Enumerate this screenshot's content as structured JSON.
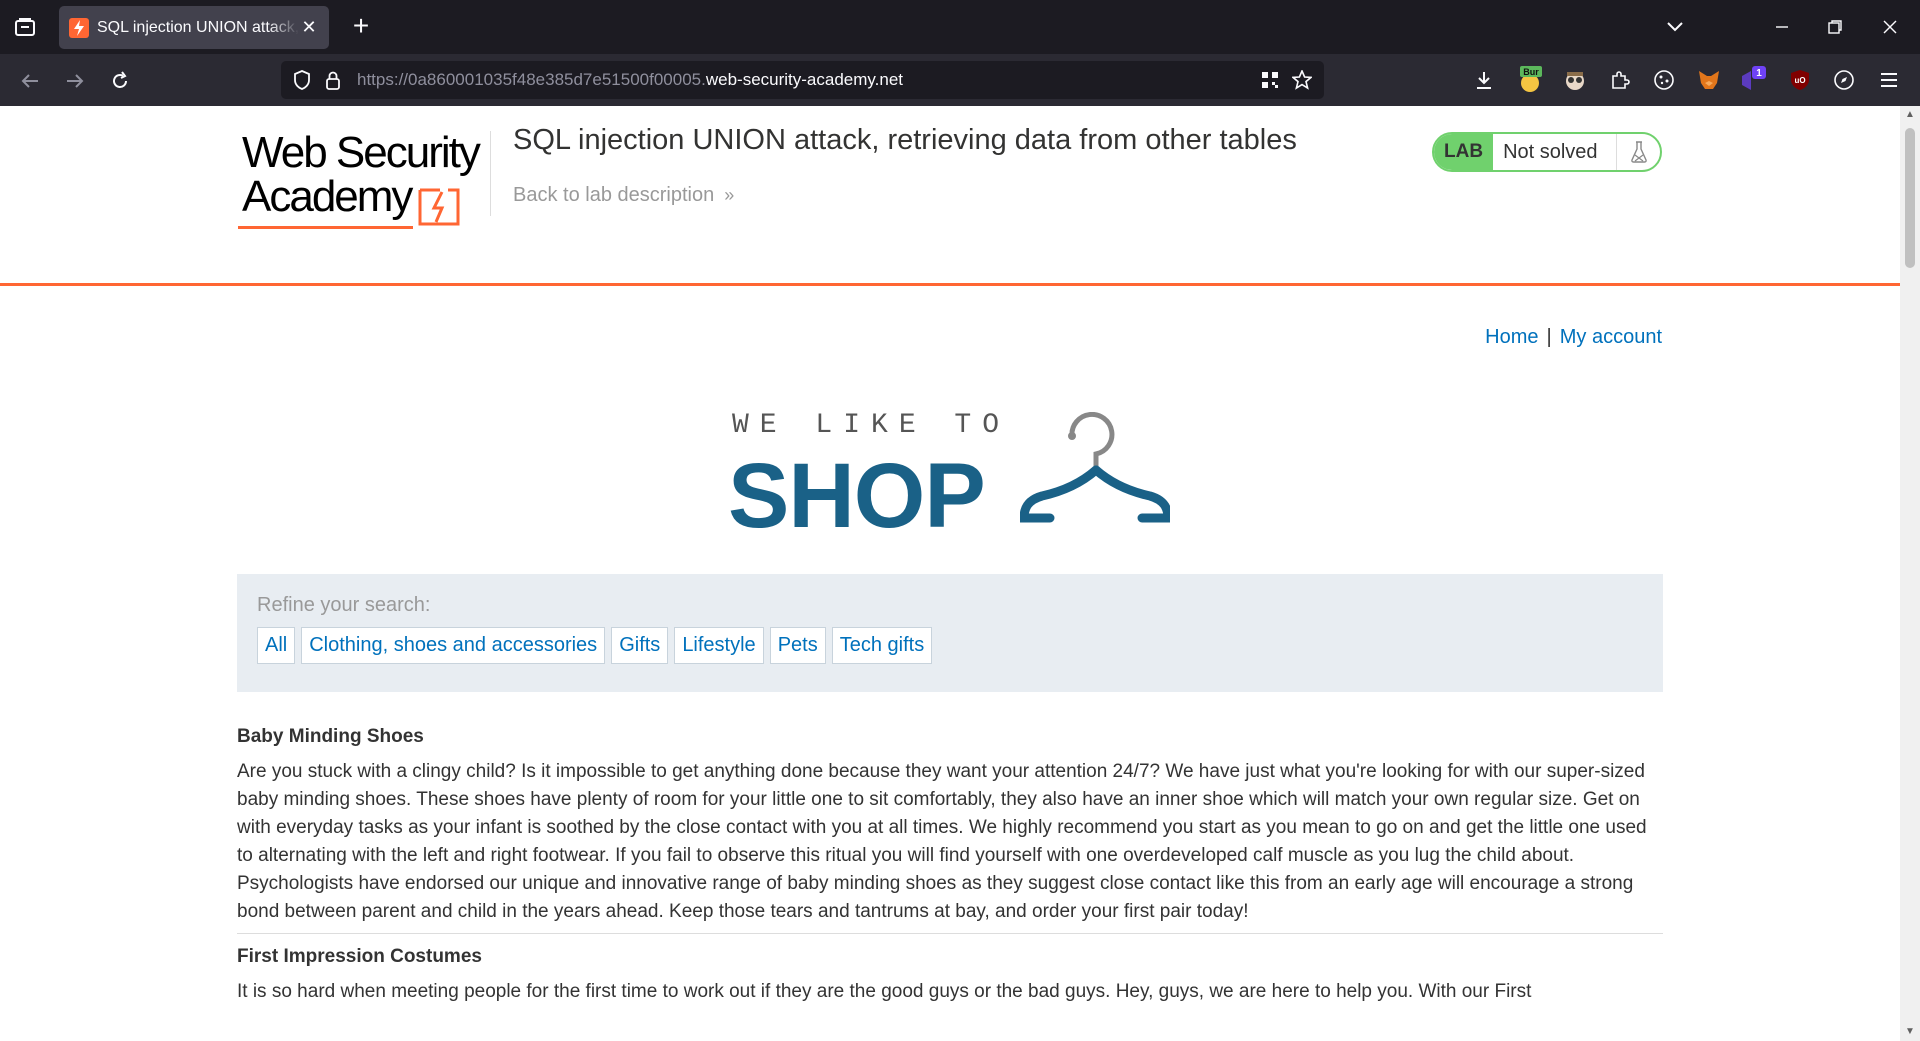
{
  "browser": {
    "tab_title": "SQL injection UNION attack, retrieving data from other tables",
    "url_prefix": "https://0a860001035f48e385d7e51500f00005.",
    "url_host": "web-security-academy.net",
    "colors": {
      "chrome_bg": "#1c1b22",
      "toolbar_bg": "#2b2a33"
    }
  },
  "header": {
    "logo_line1": "Web Security",
    "logo_line2": "Academy",
    "lab_title": "SQL injection UNION attack, retrieving data from other tables",
    "back_link": "Back to lab description",
    "status_badge": "LAB",
    "status_text": "Not solved",
    "colors": {
      "accent": "#ff6633",
      "status_green": "#70d16d",
      "link": "#0071bc"
    }
  },
  "nav": {
    "home": "Home",
    "separator": "|",
    "my_account": "My account"
  },
  "shop_logo": {
    "tagline": "WE LIKE TO",
    "word": "SHOP",
    "color": "#1a6187"
  },
  "filter": {
    "label": "Refine your search:",
    "categories": [
      "All",
      "Clothing, shoes and accessories",
      "Gifts",
      "Lifestyle",
      "Pets",
      "Tech gifts"
    ]
  },
  "products": [
    {
      "name": "Baby Minding Shoes",
      "description": "Are you stuck with a clingy child? Is it impossible to get anything done because they want your attention 24/7? We have just what you're looking for with our super-sized baby minding shoes. These shoes have plenty of room for your little one to sit comfortably, they also have an inner shoe which will match your own regular size. Get on with everyday tasks as your infant is soothed by the close contact with you at all times. We highly recommend you start as you mean to go on and get the little one used to alternating with the left and right footwear. If you fail to observe this ritual you will find yourself with one overdeveloped calf muscle as you lug the child about. Psychologists have endorsed our unique and innovative range of baby minding shoes as they suggest close contact like this from an early age will encourage a strong bond between parent and child in the years ahead. Keep those tears and tantrums at bay, and order your first pair today!"
    },
    {
      "name": "First Impression Costumes",
      "description": "It is so hard when meeting people for the first time to work out if they are the good guys or the bad guys. Hey, guys, we are here to help you. With our First"
    }
  ],
  "extensions": {
    "burp_badge": "Bur",
    "notification_count": "1"
  }
}
